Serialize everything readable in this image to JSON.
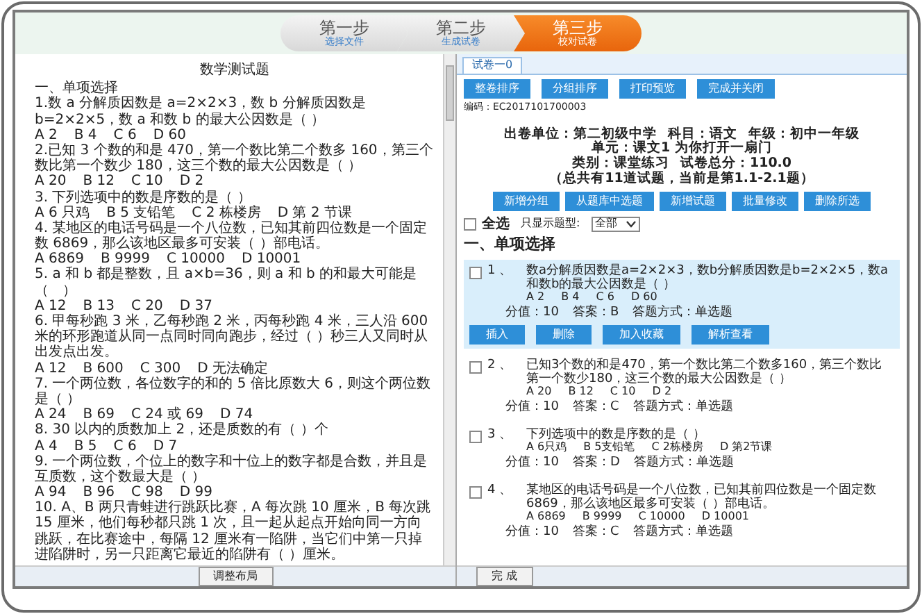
{
  "steps": [
    {
      "title": "第一步",
      "subtitle": "选择文件",
      "selected": false
    },
    {
      "title": "第二步",
      "subtitle": "生成试卷",
      "selected": false
    },
    {
      "title": "第三步",
      "subtitle": "校对试卷",
      "selected": true
    }
  ],
  "document": {
    "title": "数学测试题",
    "section": "一、单项选择",
    "questions": [
      {
        "text": "1.数 a 分解质因数是 a=2×2×3，数 b 分解质因数是 b=2×2×5，数 a 和数 b 的最大公因数是（ ）",
        "options": [
          "A 2",
          "B 4",
          "C 6",
          "D 60"
        ]
      },
      {
        "text": "2.已知 3 个数的和是 470，第一个数比第二个数多 160，第三个数比第一个数少 180，这三个数的最大公因数是（ ）",
        "options": [
          "A 20",
          "B 12",
          "C 10",
          "D 2"
        ]
      },
      {
        "text": "3. 下列选项中的数是序数的是（ ）",
        "options": [
          "A 6 只鸡",
          "B 5 支铅笔",
          "C 2 栋楼房",
          "D 第 2 节课"
        ]
      },
      {
        "text": "4. 某地区的电话号码是一个八位数，已知其前四位数是一个固定数 6869，那么该地区最多可安装（ ）部电话。",
        "options": [
          "A 6869",
          "B 9999",
          "C 10000",
          "D 10001"
        ]
      },
      {
        "text": "5. a 和 b 都是整数，且 a×b=36，则 a 和 b 的和最大可能是（　）",
        "options": [
          "A 12",
          "B 13",
          "C 20",
          "D 37"
        ]
      },
      {
        "text": "6. 甲每秒跑 3 米，乙每秒跑 2 米，丙每秒跑 4 米，三人沿 600 米的环形跑道从同一点同时同向跑步，经过（ ）秒三人又同时从出发点出发。",
        "options": [
          "A 12",
          "B 600",
          "C 300",
          "D 无法确定"
        ]
      },
      {
        "text": "7. 一个两位数，各位数字的和的 5 倍比原数大 6，则这个两位数是（ ）",
        "options": [
          "A 24",
          "B 69",
          "C 24 或 69",
          "D 74"
        ]
      },
      {
        "text": "8. 30 以内的质数加上 2，还是质数的有（ ）个",
        "options": [
          "A 4",
          "B 5",
          "C 6",
          "D 7"
        ]
      },
      {
        "text": "9. 一个两位数，个位上的数字和十位上的数字都是合数，并且是互质数，这个数最大是（ ）",
        "options": [
          "A 94",
          "B 96",
          "C 98",
          "D 99"
        ]
      },
      {
        "text": "10. A、B 两只青蛙进行跳跃比赛，A 每次跳 10 厘米，B 每次跳 15 厘米，他们每秒都只跳 1 次，且一起从起点开始向同一方向跳跃，在比赛途中，每隔 12 厘米有一陷阱，当它们中第一只掉进陷阱时，另一只距离它最近的陷阱有（ ）厘米。"
      }
    ],
    "button": "调整布局"
  },
  "paper": {
    "tab": {
      "label": "试卷一0",
      "selected": true
    },
    "toolbar": [
      "整卷排序",
      "分组排序",
      "打印预览",
      "完成并关闭"
    ],
    "code": "编码：EC2017101700003",
    "info": [
      "出卷单位：第二初级中学",
      "科目：语文",
      "年级：初中一年级",
      "单元：课文1 为你打开一扇门"
    ],
    "info2": [
      "类别：课堂练习",
      "试卷总分：110.0"
    ],
    "summary": "（总共有11道试题，当前是第1.1-2.1题）",
    "actions": [
      "新增分组",
      "从题库中选题",
      "新增试题",
      "批量修改",
      "删除所选"
    ],
    "select_all": {
      "label": "全选",
      "checked": false
    },
    "filter": {
      "label": "只显示题型:",
      "value": "全部"
    },
    "section": "一、单项选择",
    "questions": [
      {
        "number": "1 、",
        "text": "数a分解质因数是a=2×2×3，数b分解质因数是b=2×2×5，数a和数b的最大公因数是（ ）",
        "options": [
          "A 2",
          "B 4",
          "C 6",
          "D 60"
        ],
        "score": "分值：10",
        "answer": "答案：B",
        "type": "答题方式：单选题",
        "checked": false,
        "selected": true,
        "buttons": [
          "插入",
          "删除",
          "加入收藏",
          "解析查看"
        ]
      },
      {
        "number": "2 、",
        "text": "已知3个数的和是470，第一个数比第二个数多160，第三个数比第一个数少180，这三个数的最大公因数是（ ）",
        "options": [
          "A 20",
          "B 12",
          "C 10",
          "D 2"
        ],
        "score": "分值：10",
        "answer": "答案：C",
        "type": "答题方式：单选题",
        "checked": false,
        "selected": false
      },
      {
        "number": "3 、",
        "text": "下列选项中的数是序数的是（ ）",
        "options": [
          "A 6只鸡",
          "B 5支铅笔",
          "C 2栋楼房",
          "D 第2节课"
        ],
        "score": "分值：10",
        "answer": "答案：D",
        "type": "答题方式：单选题",
        "checked": false,
        "selected": false
      },
      {
        "number": "4 、",
        "text": "某地区的电话号码是一个八位数，已知其前四位数是一个固定数6869，那么该地区最多可安装（ ）部电话。",
        "options": [
          "A 6869",
          "B 9999",
          "C 10000",
          "D 10001"
        ],
        "score": "分值：10",
        "answer": "答案：C",
        "type": "答题方式：单选题",
        "checked": false,
        "selected": false
      }
    ],
    "button": "完 成"
  }
}
